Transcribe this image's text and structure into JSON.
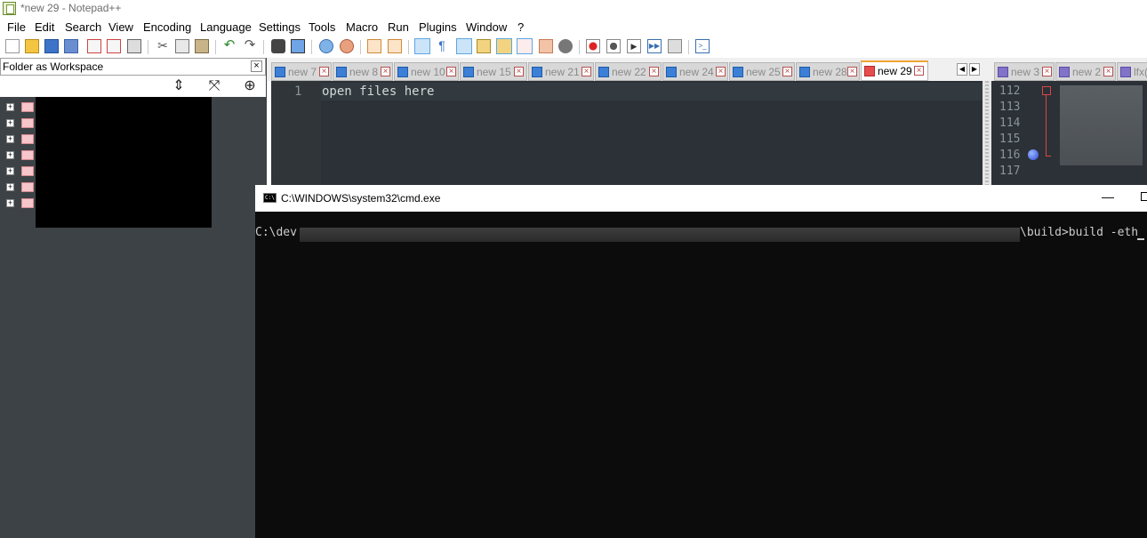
{
  "window": {
    "title": "*new 29 - Notepad++"
  },
  "menu": [
    "File",
    "Edit",
    "Search",
    "View",
    "Encoding",
    "Language",
    "Settings",
    "Tools",
    "Macro",
    "Run",
    "Plugins",
    "Window",
    "?"
  ],
  "panel": {
    "title": "Folder as Workspace",
    "close": "×"
  },
  "tabs": [
    {
      "label": "new 7"
    },
    {
      "label": "new 8"
    },
    {
      "label": "new 10"
    },
    {
      "label": "new 15"
    },
    {
      "label": "new 21"
    },
    {
      "label": "new 22"
    },
    {
      "label": "new 24"
    },
    {
      "label": "new 25"
    },
    {
      "label": "new 28"
    },
    {
      "label": "new 29",
      "active": true
    }
  ],
  "tabs2": [
    {
      "label": "new 3"
    },
    {
      "label": "new 2"
    },
    {
      "label": "lfx("
    }
  ],
  "editor": {
    "line_number": "1",
    "line_text": "open files here"
  },
  "editor2": {
    "line_numbers": [
      "112",
      "113",
      "114",
      "115",
      "116",
      "117"
    ]
  },
  "cmd": {
    "title": "C:\\WINDOWS\\system32\\cmd.exe",
    "prompt_prefix": "C:\\dev",
    "prompt_suffix": "\\build>build -eth",
    "minimize": "—"
  },
  "colors": {
    "panel_bg": "#3c4245",
    "editor_bg": "#2b3136",
    "active_tab_accent": "#f2a535",
    "console_bg": "#0c0c0c"
  }
}
